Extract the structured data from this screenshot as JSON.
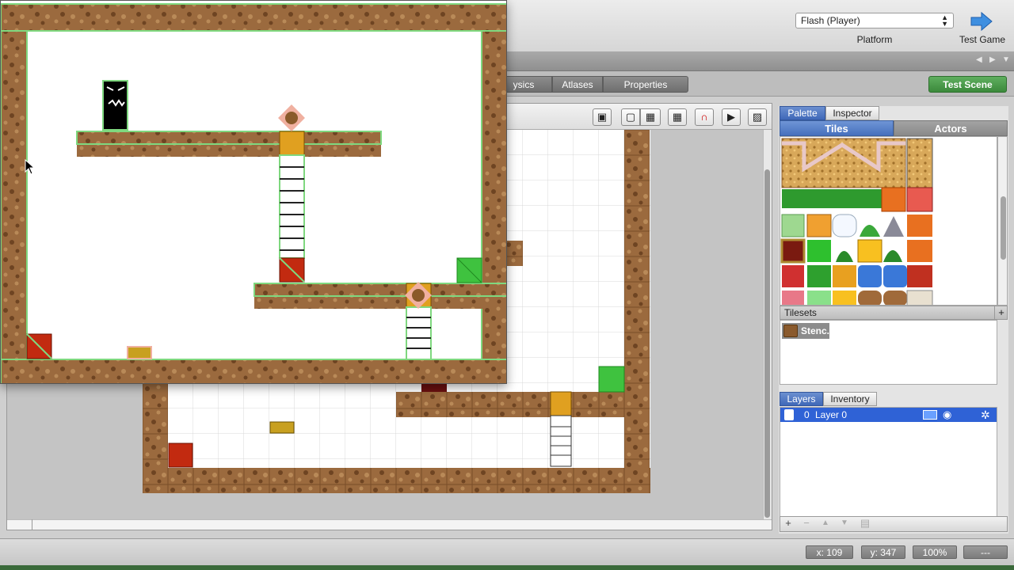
{
  "toolbar": {
    "platform_value": "Flash (Player)",
    "platform_label": "Platform",
    "test_game_label": "Test Game",
    "test_game_icon": "right-arrow-icon"
  },
  "tabs": [
    {
      "label": "ysics"
    },
    {
      "label": "Atlases"
    },
    {
      "label": "Properties"
    }
  ],
  "test_scene_label": "Test Scene",
  "panel": {
    "top_tabs": [
      {
        "label": "Palette"
      },
      {
        "label": "Inspector"
      }
    ],
    "sub_tabs": [
      {
        "label": "Tiles"
      },
      {
        "label": "Actors"
      }
    ],
    "tilesets_header": "Tilesets",
    "tileset_name": "Stenc..",
    "add_label": "+",
    "layer_tabs": [
      {
        "label": "Layers"
      },
      {
        "label": "Inventory"
      }
    ],
    "layer_row": {
      "index": "0",
      "name": "Layer 0"
    }
  },
  "status": {
    "x": "x:  109",
    "y": "y:  347",
    "zoom": "100%",
    "extra": "---"
  },
  "colors": {
    "dirt": "#9b6a3e",
    "grass_outline": "#7fd87f",
    "accent_green": "#3b8a3b",
    "selection_blue": "#2f62d6"
  }
}
